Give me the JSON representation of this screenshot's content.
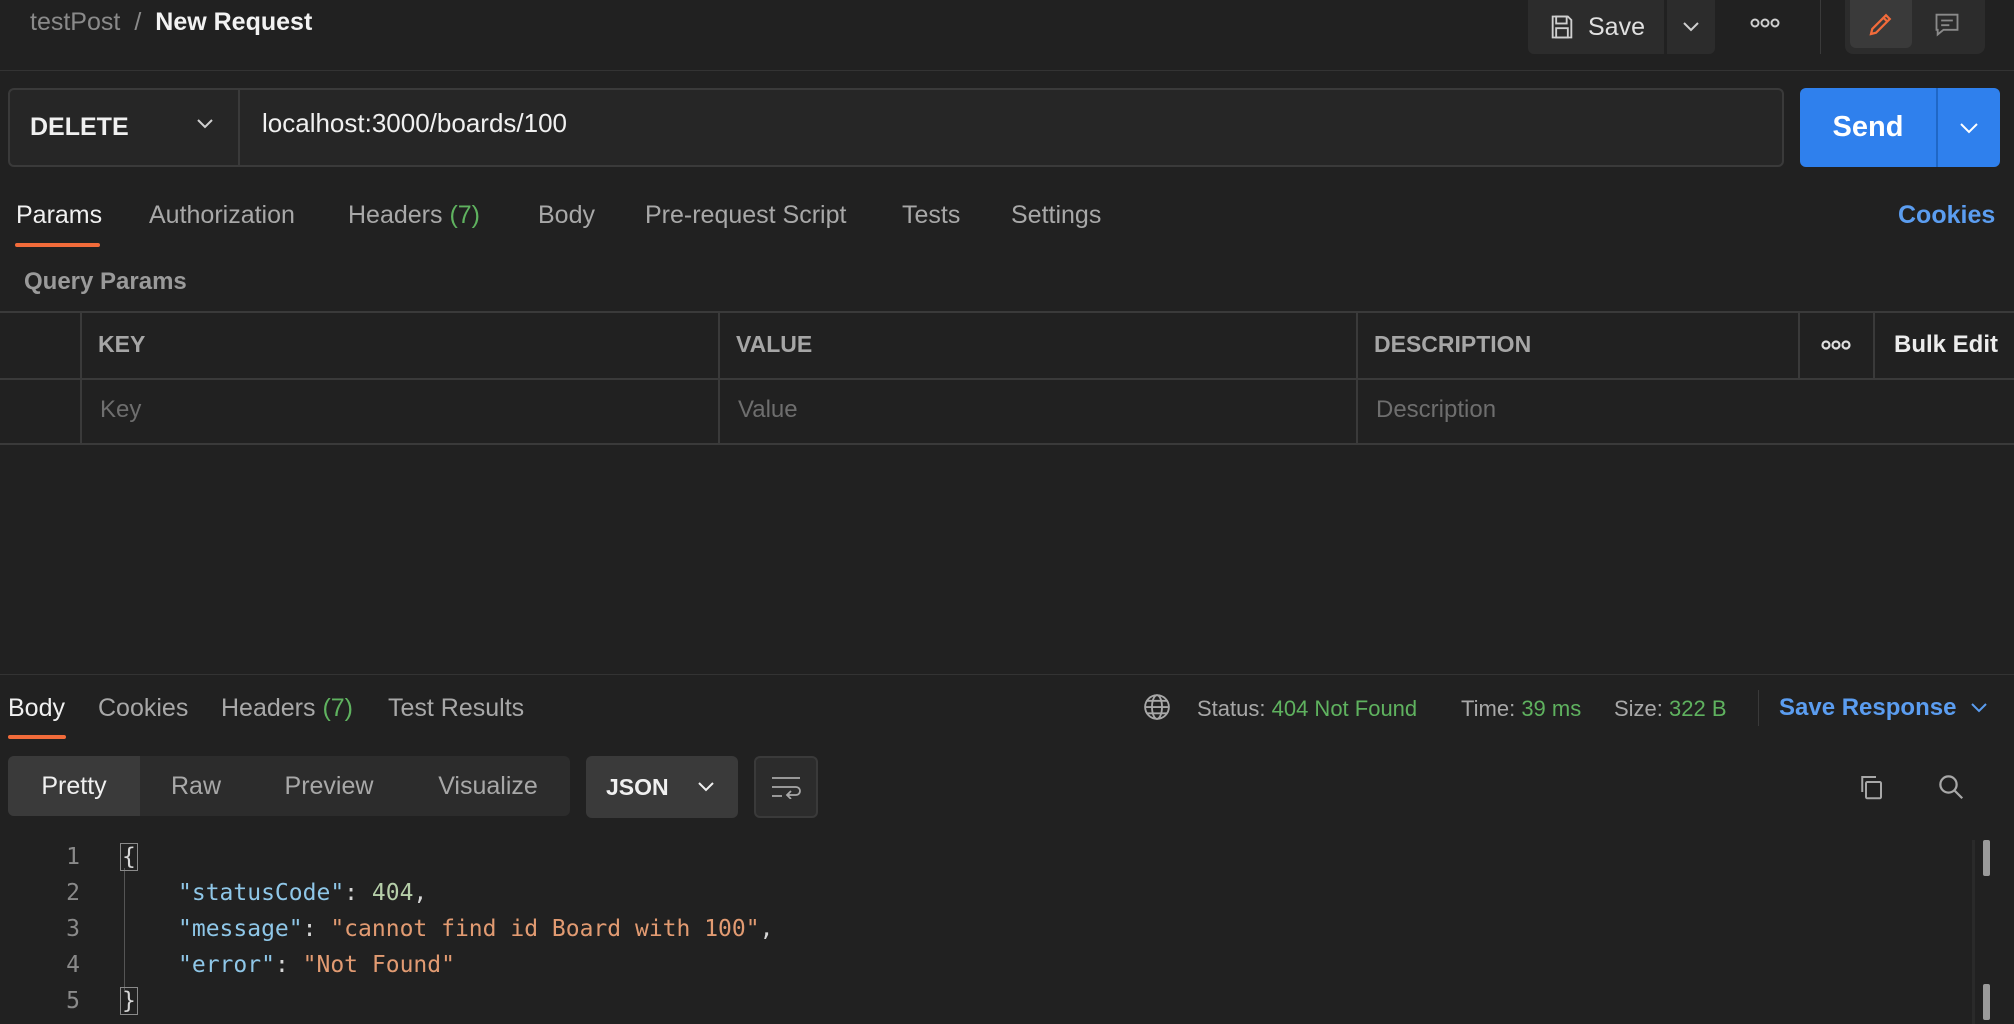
{
  "header": {
    "breadcrumb_parent": "testPost",
    "breadcrumb_sep": "/",
    "breadcrumb_current": "New Request",
    "save_label": "Save"
  },
  "request": {
    "method": "DELETE",
    "url": "localhost:3000/boards/100",
    "send_label": "Send"
  },
  "request_tabs": [
    {
      "label": "Params",
      "active": true
    },
    {
      "label": "Authorization"
    },
    {
      "label": "Headers",
      "count": "(7)"
    },
    {
      "label": "Body"
    },
    {
      "label": "Pre-request Script"
    },
    {
      "label": "Tests"
    },
    {
      "label": "Settings"
    }
  ],
  "cookies_link": "Cookies",
  "query_params": {
    "title": "Query Params",
    "columns": [
      "KEY",
      "VALUE",
      "DESCRIPTION"
    ],
    "bulk_edit": "Bulk Edit",
    "placeholders": {
      "key": "Key",
      "value": "Value",
      "description": "Description"
    }
  },
  "response": {
    "tabs": [
      {
        "label": "Body",
        "active": true
      },
      {
        "label": "Cookies"
      },
      {
        "label": "Headers",
        "count": "(7)"
      },
      {
        "label": "Test Results"
      }
    ],
    "status_label": "Status:",
    "status_value": "404 Not Found",
    "time_label": "Time:",
    "time_value": "39 ms",
    "size_label": "Size:",
    "size_value": "322 B",
    "save_response": "Save Response",
    "view_tabs": [
      "Pretty",
      "Raw",
      "Preview",
      "Visualize"
    ],
    "format": "JSON",
    "lines": [
      "1",
      "2",
      "3",
      "4",
      "5"
    ],
    "body": {
      "open": "{",
      "k1": "\"statusCode\"",
      "v1": "404",
      "k2": "\"message\"",
      "v2": "\"cannot find id Board with 100\"",
      "k3": "\"error\"",
      "v3": "\"Not Found\"",
      "close": "}"
    }
  },
  "colors": {
    "accent_send": "#2f80ed",
    "active_tab_underline": "#f26b3a",
    "status_ok_text": "#5fb25f",
    "link": "#5b9df0"
  }
}
